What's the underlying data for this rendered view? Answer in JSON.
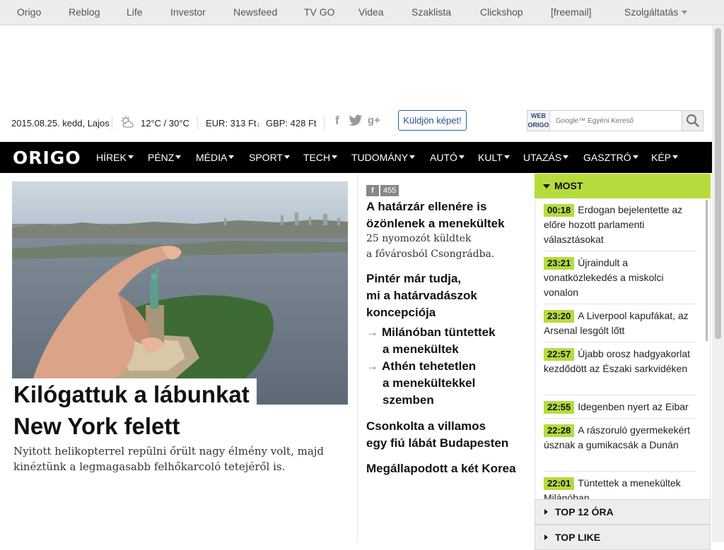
{
  "topnav": {
    "items": [
      "Origo",
      "Reblog",
      "Life",
      "Investor",
      "Newsfeed",
      "TV GO",
      "Videa",
      "Szaklista",
      "Clickshop",
      "[freemail]",
      "Szolgáltatás"
    ]
  },
  "info": {
    "date": "2015.08.25. kedd, Lajos",
    "weather": "12°C / 30°C",
    "eur": "EUR: 313 Ft",
    "gbp": "GBP: 428 Ft",
    "send_photo": "Küldjön képet!",
    "search_label_top": "WEB",
    "search_label_bottom": "ORIGO",
    "search_placeholder": "Google™ Egyéni Kereső"
  },
  "mainnav": {
    "logo": "ORIGO",
    "items": [
      "HÍREK",
      "PÉNZ",
      "MÉDIA",
      "SPORT",
      "TECH",
      "TUDOMÁNY",
      "AUTÓ",
      "KULT",
      "UTAZÁS",
      "GASZTRÓ",
      "KÉP"
    ]
  },
  "hero": {
    "title_line1": "Kilógattuk a lábunkat",
    "title_line2": "New York felett",
    "lead": "Nyitott helikopterrel repülni őrült nagy élmény volt, majd kinéztünk a legmagasabb felhőkarcoló tetejéről is."
  },
  "middle": {
    "fb_icon": "f",
    "fb_count": "455",
    "h1_l1": "A határzár ellenére is",
    "h1_l2": "özönlenek a menekültek",
    "sub1_l1": "25 nyomozót küldtek",
    "sub1_l2": "a fővárosból Csongrádba.",
    "h2_l1": "Pintér már tudja,",
    "h2_l2": "mi a határvadászok",
    "h2_l3": "koncepciója",
    "rel1_l1": "Milánóban tüntettek",
    "rel1_l2": "a menekültek",
    "rel2_l1": "Athén tehetetlen",
    "rel2_l2": "a menekültekkel",
    "rel2_l3": "szemben",
    "h3_l1": "Csonkolta a villamos",
    "h3_l2": "egy fiú lábát Budapesten",
    "h4": "Megállapodott a két Korea"
  },
  "sidebar": {
    "most_title": "MOST",
    "items": [
      {
        "time": "00:18",
        "text": "Erdogan bejelentette az előre hozott parlamenti választásokat"
      },
      {
        "time": "23:21",
        "text": "Újraindult a vonatközlekedés a miskolci vonalon"
      },
      {
        "time": "23:20",
        "text": "A Liverpool kapufákat, az Arsenal lesgólt lőtt"
      },
      {
        "time": "22:57",
        "text": "Újabb orosz hadgyakorlat kezdődött az Északi sarkvidéken"
      },
      {
        "time": "22:55",
        "text": "Idegenben nyert az Eibar"
      },
      {
        "time": "22:28",
        "text": "A rászoruló gyermekekért úsznak a gumikacsák a Dunán"
      },
      {
        "time": "22:01",
        "text": "Tüntettek a menekültek Milánóban"
      }
    ],
    "tab_top12": "TOP 12 ÓRA",
    "tab_toplike": "TOP LIKE"
  },
  "colors": {
    "accent": "#b5dc3c",
    "nav_bg": "#000000",
    "topbar_bg": "#ececec"
  }
}
